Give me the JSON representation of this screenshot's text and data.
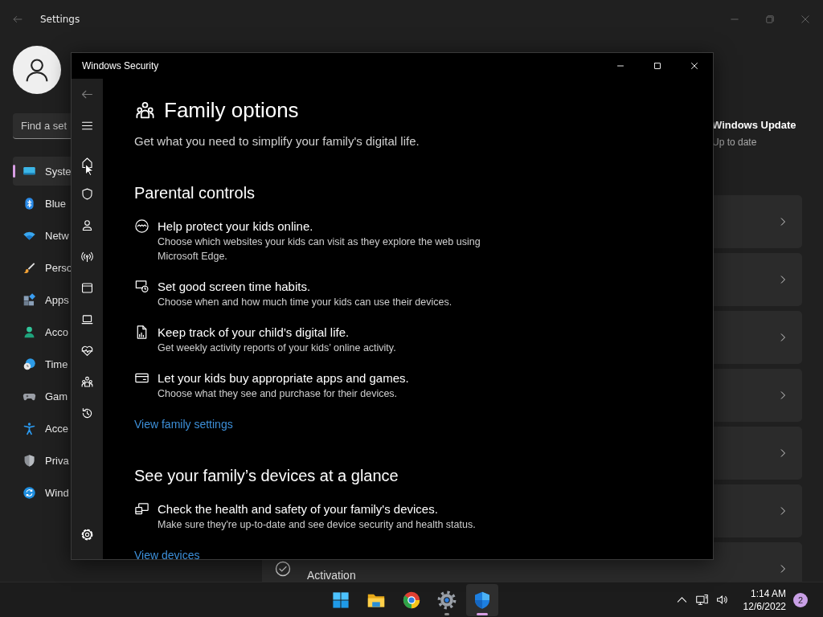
{
  "settings": {
    "title": "Settings",
    "search": {
      "placeholder": "Find a set"
    },
    "sidebar": {
      "items": [
        {
          "kind": "system",
          "label": "Syste",
          "selected": true
        },
        {
          "kind": "bluetooth",
          "label": "Blue",
          "selected": false
        },
        {
          "kind": "network",
          "label": "Netw",
          "selected": false
        },
        {
          "kind": "personalization",
          "label": "Perso",
          "selected": false
        },
        {
          "kind": "apps",
          "label": "Apps",
          "selected": false
        },
        {
          "kind": "accounts",
          "label": "Acco",
          "selected": false
        },
        {
          "kind": "time",
          "label": "Time",
          "selected": false
        },
        {
          "kind": "gaming",
          "label": "Gam",
          "selected": false
        },
        {
          "kind": "accessibility",
          "label": "Acce",
          "selected": false
        },
        {
          "kind": "privacy",
          "label": "Priva",
          "selected": false
        },
        {
          "kind": "update",
          "label": "Wind",
          "selected": false
        }
      ]
    },
    "update": {
      "title": "Windows Update",
      "status": "Up to date"
    },
    "cards": [
      {
        "kind": "plain"
      },
      {
        "kind": "plain"
      },
      {
        "kind": "plain"
      },
      {
        "kind": "plain"
      },
      {
        "kind": "plain"
      },
      {
        "kind": "plain"
      },
      {
        "kind": "labeled",
        "title": "Activation"
      }
    ]
  },
  "security": {
    "title": "Windows Security",
    "nav": [
      {
        "kind": "back"
      },
      {
        "kind": "menu"
      },
      {
        "kind": "home"
      },
      {
        "kind": "shield"
      },
      {
        "kind": "account"
      },
      {
        "kind": "network"
      },
      {
        "kind": "app"
      },
      {
        "kind": "device"
      },
      {
        "kind": "health"
      },
      {
        "kind": "family"
      },
      {
        "kind": "history"
      },
      {
        "kind": "settings"
      }
    ],
    "page": {
      "title": "Family options",
      "subtitle": "Get what you need to simplify your family's digital life.",
      "sections": [
        {
          "heading": "Parental controls",
          "items": [
            {
              "kind": "web",
              "title": "Help protect your kids online.",
              "description": "Choose which websites your kids can visit as they explore the web using Microsoft Edge."
            },
            {
              "kind": "screen-time",
              "title": "Set good screen time habits.",
              "description": "Choose when and how much time your kids can use their devices."
            },
            {
              "kind": "report",
              "title": "Keep track of your child’s digital life.",
              "description": "Get weekly activity reports of your kids’ online activity."
            },
            {
              "kind": "purchase",
              "title": "Let your kids buy appropriate apps and games.",
              "description": "Choose what they see and purchase for their devices."
            }
          ],
          "link": "View family settings"
        },
        {
          "heading": "See your family’s devices at a glance",
          "items": [
            {
              "kind": "devices",
              "title": "Check the health and safety of your family's devices.",
              "description": "Make sure they're up-to-date and see device security and health status."
            }
          ],
          "link": "View devices"
        }
      ]
    }
  },
  "taskbar": {
    "apps": [
      {
        "kind": "start",
        "selected": false,
        "running": false
      },
      {
        "kind": "folder",
        "selected": false,
        "running": false
      },
      {
        "kind": "browser",
        "selected": false,
        "running": false
      },
      {
        "kind": "settings",
        "selected": false,
        "running": true
      },
      {
        "kind": "security",
        "selected": true,
        "running": true
      }
    ],
    "time": "1:14 AM",
    "date": "12/6/2022",
    "badge": "2"
  }
}
